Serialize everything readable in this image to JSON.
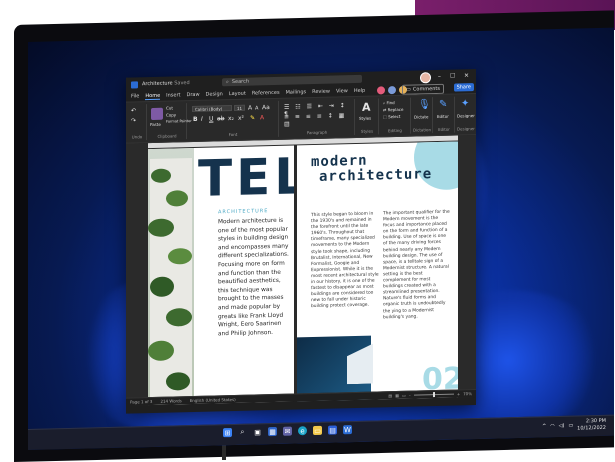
{
  "window": {
    "doc_title": "Architecture",
    "save_state": "Saved",
    "search_placeholder": "Search",
    "controls": {
      "minimize": "–",
      "maximize": "☐",
      "close": "✕"
    }
  },
  "ribbon_tabs": [
    "File",
    "Home",
    "Insert",
    "Draw",
    "Design",
    "Layout",
    "References",
    "Mailings",
    "Review",
    "View",
    "Help"
  ],
  "active_tab": "Home",
  "actions": {
    "comments": "Comments",
    "share": "Share"
  },
  "ribbon": {
    "font_name": "Calibri (Body)",
    "font_size": "11",
    "groups": [
      "Clipboard",
      "Font",
      "Paragraph",
      "Styles",
      "Editing",
      "Dictation",
      "Editor",
      "Designer"
    ],
    "clipboard": {
      "paste": "Paste",
      "cut": "Cut",
      "copy": "Copy",
      "format_painter": "Format Painter",
      "undo": "Undo",
      "redo": "Redo"
    },
    "font_buttons": {
      "bold": "B",
      "italic": "I",
      "underline": "U",
      "strike": "ab",
      "sub": "x₂",
      "sup": "x²",
      "grow": "A",
      "shrink": "A",
      "case": "Aa"
    },
    "styles_label": "Styles",
    "editing": {
      "find": "Find",
      "replace": "Replace",
      "select": "Select"
    },
    "dictate": "Dictate",
    "editor": "Editor",
    "designer": "Designer"
  },
  "document": {
    "left_heading": "TELL",
    "section_label": "ARCHITECTURE",
    "left_body": "Modern architecture is one of the most popular styles in building design and encompasses many different specializations. Focusing more on form and function than the beautified aesthetics, this technique was brought to the masses and made popular by greats like Frank Lloyd Wright, Eero Saarinen and Philip Johnson.",
    "right_title_line1": "modern",
    "right_title_line2": "architecture",
    "col1": "This style began to bloom in the 1930's and remained in the forefront until the late 1960's. Throughout that timeframe, many specialized movements to the Modern style took shape, including Brutalist, International, New Formalist, Googie and Expressionist. While it is the most recent architectural style in our history, it is one of the fastest to disappear as most buildings are considered too new to fall under historic building protect coverage.",
    "col2": "The important qualifier for the Modern movement is the focus and importance placed on the form and function of a building. Use of space is one of the many driving forces behind nearly any Modern building design. The use of space, is a telltale sign of a Modernist structure. A natural setting is the best complement for most buildings created with a streamlined presentation. Nature's fluid forms and organic truth is undoubtedly the ying to a Modernist building's yang.",
    "page_number_graphic": "02"
  },
  "status": {
    "page": "Page 1 of 3",
    "words": "214 Words",
    "language": "English (United States)",
    "zoom": "70%",
    "zoom_level": 0.7
  },
  "taskbar": {
    "time": "2:30 PM",
    "date": "10/12/2022",
    "apps": [
      "windows-icon",
      "search-icon",
      "task-view-icon",
      "widgets-icon",
      "chat-icon",
      "edge-icon",
      "file-explorer-icon",
      "store-icon",
      "word-icon"
    ]
  },
  "colors": {
    "accent": "#2b6cd4",
    "wallpaper": "#0a2e9a",
    "heading": "#15334d",
    "cyan": "#a8dbe6",
    "label": "#4aa8c4"
  }
}
